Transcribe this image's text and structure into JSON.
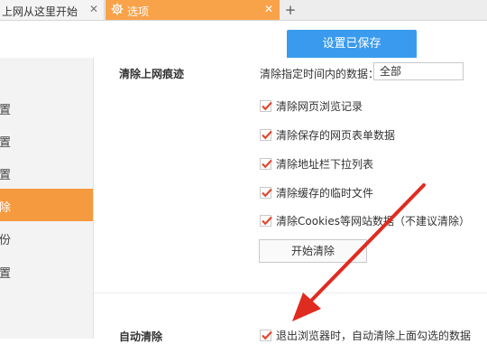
{
  "tabs": [
    {
      "title": "上网从这里开始",
      "close": "✕"
    },
    {
      "title": "选项",
      "close": "✕",
      "icon": "gear-icon"
    }
  ],
  "new_tab": "+",
  "header": {
    "saved_label": "设置已保存"
  },
  "sidebar": {
    "items": [
      {
        "label": "置"
      },
      {
        "label": "置"
      },
      {
        "label": "置"
      },
      {
        "label": "除"
      },
      {
        "label": "份"
      },
      {
        "label": "置"
      }
    ],
    "active_index": 3
  },
  "main": {
    "section_title": "清除上网痕迹",
    "range_label": "清除指定时间内的数据：",
    "range_value": "全部",
    "options": [
      {
        "label": "清除网页浏览记录",
        "checked": true
      },
      {
        "label": "清除保存的网页表单数据",
        "checked": true
      },
      {
        "label": "清除地址栏下拉列表",
        "checked": true
      },
      {
        "label": "清除缓存的临时文件",
        "checked": true
      },
      {
        "label": "清除Cookies等网站数据（不建议清除）",
        "checked": true
      }
    ],
    "clear_button": "开始清除",
    "auto_section_title": "自动清除",
    "auto_option": {
      "label": "退出浏览器时，自动清除上面勾选的数据",
      "checked": true
    }
  },
  "colors": {
    "accent_orange": "#f59a3f",
    "saved_blue": "#3a9bee",
    "check_red": "#e2482e",
    "arrow_red": "#e02b20"
  }
}
